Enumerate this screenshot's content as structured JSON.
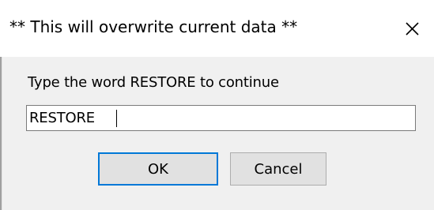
{
  "window": {
    "title": "** This will overwrite current data **",
    "close_icon": "close-icon"
  },
  "form": {
    "prompt": "Type the word RESTORE to continue",
    "input_value": "RESTORE",
    "input_placeholder": ""
  },
  "buttons": {
    "ok_label": "OK",
    "cancel_label": "Cancel"
  },
  "colors": {
    "dialog_bg": "#f0f0f0",
    "titlebar_bg": "#ffffff",
    "default_button_border": "#0078d7",
    "button_bg": "#e1e1e1"
  }
}
